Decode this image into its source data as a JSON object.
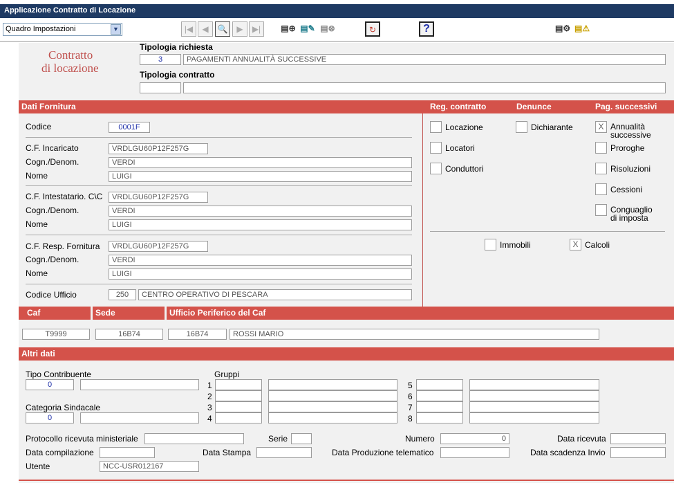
{
  "window": {
    "title": "Applicazione Contratto di Locazione"
  },
  "toolbar": {
    "view_select": "Quadro Impostazioni",
    "help_glyph": "?"
  },
  "logo": {
    "line1": "Contratto",
    "line2": "di locazione"
  },
  "header": {
    "tipologia_richiesta_label": "Tipologia richiesta",
    "tipologia_richiesta_code": "3",
    "tipologia_richiesta_desc": "PAGAMENTI ANNUALITÀ SUCCESSIVE",
    "tipologia_contratto_label": "Tipologia contratto",
    "tipologia_contratto_code": "",
    "tipologia_contratto_desc": ""
  },
  "dati_fornitura": {
    "title": "Dati Fornitura",
    "codice_label": "Codice",
    "codice": "0001F",
    "cf_incaricato_label": "C.F. Incaricato",
    "cf_incaricato": "VRDLGU60P12F257G",
    "cognome1_label": "Cogn./Denom.",
    "cognome1": "VERDI",
    "nome1_label": "Nome",
    "nome1": "LUIGI",
    "cf_intestatario_label": "C.F. Intestatario. C\\C",
    "cf_intestatario": "VRDLGU60P12F257G",
    "cognome2_label": "Cogn./Denom.",
    "cognome2": "VERDI",
    "nome2_label": "Nome",
    "nome2": "LUIGI",
    "cf_resp_label": "C.F. Resp. Fornitura",
    "cf_resp": "VRDLGU60P12F257G",
    "cognome3_label": "Cogn./Denom.",
    "cognome3": "VERDI",
    "nome3_label": "Nome",
    "nome3": "LUIGI",
    "codice_ufficio_label": "Codice Ufficio",
    "codice_ufficio": "250",
    "ufficio_desc": "CENTRO OPERATIVO DI PESCARA"
  },
  "options": {
    "reg_contratto_title": "Reg. contratto",
    "denunce_title": "Denunce",
    "pag_successivi_title": "Pag. successivi",
    "locazione": "Locazione",
    "locatori": "Locatori",
    "conduttori": "Conduttori",
    "dichiarante": "Dichiarante",
    "annualita_1": "Annualità",
    "annualita_2": "successive",
    "annualita_mark": "X",
    "proroghe": "Proroghe",
    "risoluzioni": "Risoluzioni",
    "cessioni": "Cessioni",
    "conguaglio_1": "Conguaglio",
    "conguaglio_2": "di imposta",
    "immobili": "Immobili",
    "calcoli": "Calcoli",
    "calcoli_mark": "X"
  },
  "caf": {
    "caf_title": "Caf",
    "sede_title": "Sede",
    "ufficio_title": "Ufficio Periferico del Caf",
    "caf": "T9999",
    "sede": "16B74",
    "ufficio_code": "16B74",
    "ufficio_name": "ROSSI MARIO"
  },
  "altri_dati": {
    "title": "Altri dati",
    "tipo_contribuente_label": "Tipo Contribuente",
    "tipo_contribuente": "0",
    "categoria_sindacale_label": "Categoria Sindacale",
    "categoria_sindacale": "0",
    "gruppi_label": "Gruppi",
    "gruppi_numbers": [
      "1",
      "2",
      "3",
      "4",
      "5",
      "6",
      "7",
      "8"
    ],
    "protocollo_label": "Protocollo ricevuta ministeriale",
    "serie_label": "Serie",
    "numero_label": "Numero",
    "numero": "0",
    "data_ricevuta_label": "Data ricevuta",
    "data_compilazione_label": "Data compilazione",
    "data_stampa_label": "Data Stampa",
    "data_produzione_label": "Data Produzione telematico",
    "data_scadenza_label": "Data scadenza Invio",
    "utente_label": "Utente",
    "utente": "NCC-USR012167"
  }
}
